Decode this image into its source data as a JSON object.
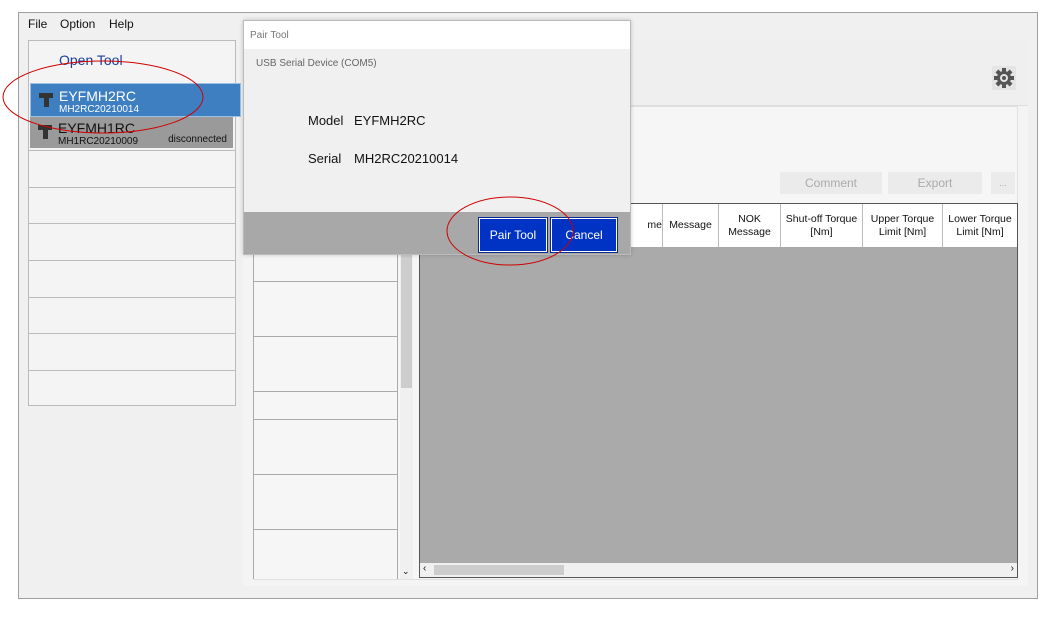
{
  "menu": [
    "File",
    "Option",
    "Help"
  ],
  "left": {
    "open_tool": "Open Tool",
    "tools": [
      {
        "model": "EYFMH2RC",
        "serial": "MH2RC20210014",
        "status": ""
      },
      {
        "model": "EYFMH1RC",
        "serial": "MH1RC20210009",
        "status": "disconnected"
      }
    ]
  },
  "toolbar": {
    "comment": "Comment",
    "export": "Export",
    "more": "..."
  },
  "table": {
    "columns": [
      "me",
      "Message",
      "NOK Message",
      "Shut-off Torque [Nm]",
      "Upper Torque Limit [Nm]",
      "Lower Torque Limit [Nm]"
    ]
  },
  "dialog": {
    "title": "Pair Tool",
    "device": "USB Serial Device (COM5)",
    "model_label": "Model",
    "model": "EYFMH2RC",
    "serial_label": "Serial",
    "serial": "MH2RC20210014",
    "pair": "Pair Tool",
    "cancel": "Cancel"
  },
  "colors": {
    "accent": "#0033c4",
    "selected": "#3d7fc1",
    "annotation": "#d00000"
  }
}
